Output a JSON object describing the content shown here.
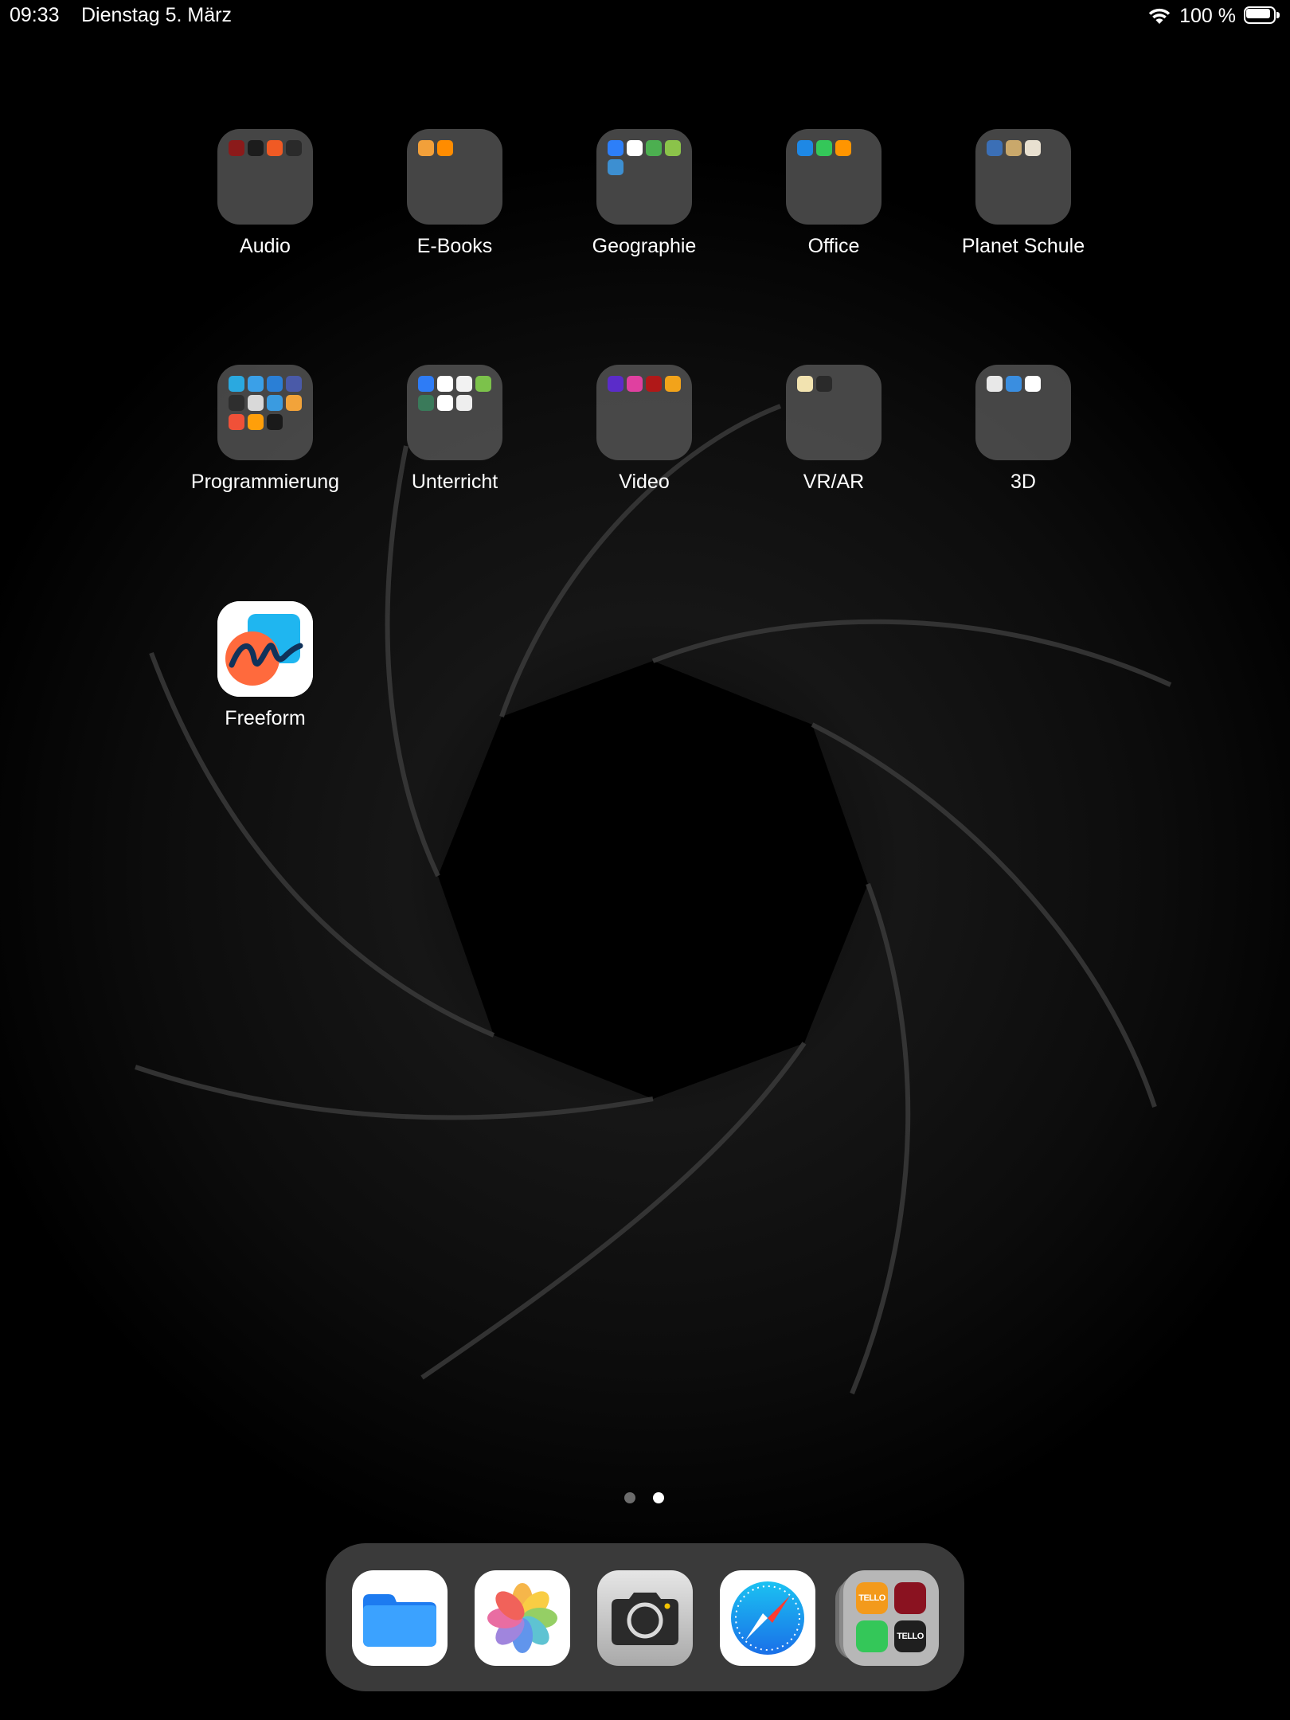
{
  "status_bar": {
    "time": "09:33",
    "date": "Dienstag 5. März",
    "battery_text": "100 %",
    "icons": [
      "wifi-icon",
      "battery-icon"
    ]
  },
  "folders": [
    {
      "label": "Audio",
      "mini_colors": [
        "#8b1a1a",
        "#1c1c1c",
        "#f05a24",
        "#2a2a2a"
      ]
    },
    {
      "label": "E-Books",
      "mini_colors": [
        "#f2a03a",
        "#ff8c00"
      ]
    },
    {
      "label": "Geographie",
      "mini_colors": [
        "#2d7ff9",
        "#ffffff",
        "#4caf50",
        "#8bc34a",
        "#3d8fd1"
      ]
    },
    {
      "label": "Office",
      "mini_colors": [
        "#1e88e5",
        "#34c759",
        "#ff9500"
      ]
    },
    {
      "label": "Planet Schule",
      "mini_colors": [
        "#3b6fb6",
        "#c9a86b",
        "#e8e0d0"
      ]
    },
    {
      "label": "Programmierung",
      "mini_colors": [
        "#2aa9e0",
        "#3aa0e8",
        "#2a7fd6",
        "#4a5aa8",
        "#2e2e2e",
        "#d9d9d9",
        "#3a9be0",
        "#f2a33a",
        "#f05138",
        "#ff9f0a",
        "#1a1a1a"
      ]
    },
    {
      "label": "Unterricht",
      "mini_colors": [
        "#2e7cf6",
        "#ffffff",
        "#f2f2f2",
        "#7cc24b",
        "#3a7a5a",
        "#ffffff",
        "#eeeeee"
      ]
    },
    {
      "label": "Video",
      "mini_colors": [
        "#5b2cc9",
        "#e040a0",
        "#b01818",
        "#f2a31a"
      ]
    },
    {
      "label": "VR/AR",
      "mini_colors": [
        "#f2e3b0",
        "#2a2a2a"
      ]
    },
    {
      "label": "3D",
      "mini_colors": [
        "#e8e8e8",
        "#3a8ee0",
        "#ffffff"
      ]
    }
  ],
  "apps": [
    {
      "label": "Freeform",
      "icon": "freeform-icon"
    }
  ],
  "page_indicator": {
    "pages": 2,
    "current": 2
  },
  "dock": {
    "apps": [
      {
        "name": "Files",
        "icon": "files-icon"
      },
      {
        "name": "Photos",
        "icon": "photos-icon"
      },
      {
        "name": "Camera",
        "icon": "camera-icon"
      },
      {
        "name": "Safari",
        "icon": "safari-icon"
      }
    ],
    "recent_stack": {
      "icon": "app-library-stack-icon",
      "tiles": [
        {
          "text": "TELLO",
          "color": "#f39a1c"
        },
        {
          "text": "",
          "color": "#8a1220"
        },
        {
          "text": "",
          "color": "#34c759"
        },
        {
          "text": "TELLO",
          "color": "#1f1f1f"
        }
      ]
    }
  }
}
